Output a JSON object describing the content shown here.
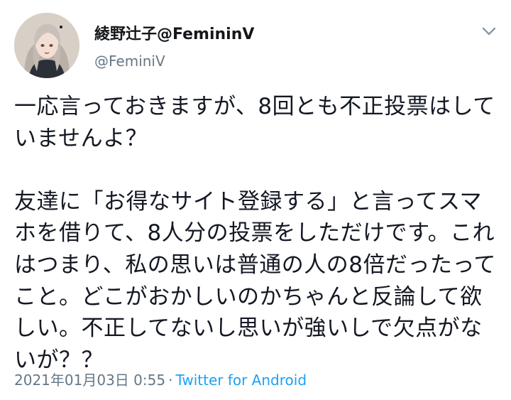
{
  "user": {
    "display_name": "綾野辻子@FemininV",
    "handle": "@FeminiV",
    "avatar_icon": "user-avatar"
  },
  "tweet": {
    "text": "一応言っておきますが、8回とも不正投票はしていませんよ？\n\n友達に「お得なサイト登録する」と言ってスマホを借りて、8人分の投票をしただけです。これはつまり、私の思いは普通の人の8倍だったってこと。どこがおかしいのかちゃんと反論して欲しい。不正してないし思いが強いしで欠点がないが？？",
    "timestamp": "2021年01月03日 0:55",
    "separator": "·",
    "source": "Twitter for Android"
  },
  "menu": {
    "icon": "chevron-down-icon"
  },
  "colors": {
    "text": "#141823",
    "muted": "#657786",
    "link": "#1da1f2"
  }
}
